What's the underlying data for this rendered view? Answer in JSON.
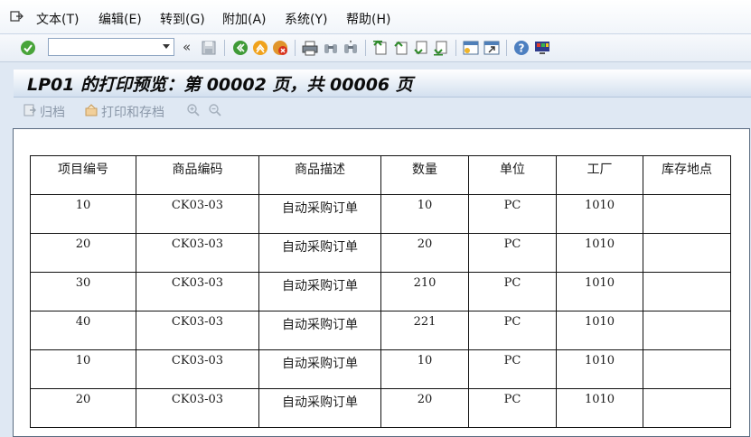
{
  "menu": {
    "items": [
      "文本(T)",
      "编辑(E)",
      "转到(G)",
      "附加(A)",
      "系统(Y)",
      "帮助(H)"
    ]
  },
  "toolbar": {
    "command_value": ""
  },
  "title": "LP01 的打印预览：第 00002 页，共 00006  页",
  "app_toolbar": {
    "archive": "归档",
    "print_archive": "打印和存档"
  },
  "table": {
    "headers": [
      "项目编号",
      "商品编码",
      "商品描述",
      "数量",
      "单位",
      "工厂",
      "库存地点"
    ],
    "rows": [
      [
        "10",
        "CK03-03",
        "自动采购订单",
        "10",
        "PC",
        "1010",
        ""
      ],
      [
        "20",
        "CK03-03",
        "自动采购订单",
        "20",
        "PC",
        "1010",
        ""
      ],
      [
        "30",
        "CK03-03",
        "自动采购订单",
        "210",
        "PC",
        "1010",
        ""
      ],
      [
        "40",
        "CK03-03",
        "自动采购订单",
        "221",
        "PC",
        "1010",
        ""
      ],
      [
        "10",
        "CK03-03",
        "自动采购订单",
        "10",
        "PC",
        "1010",
        ""
      ],
      [
        "20",
        "CK03-03",
        "自动采购订单",
        "20",
        "PC",
        "1010",
        ""
      ]
    ]
  }
}
